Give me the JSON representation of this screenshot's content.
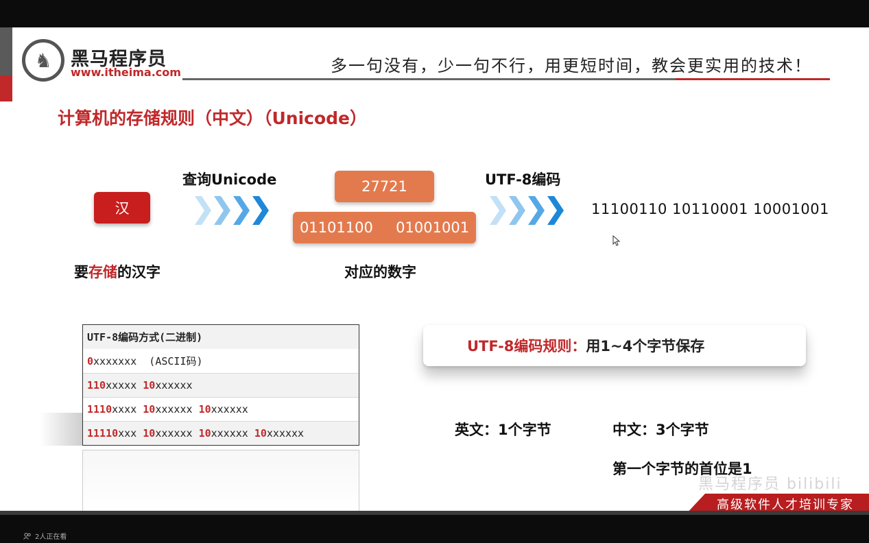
{
  "header": {
    "logo_name": "黑马程序员",
    "logo_url": "www.itheima.com",
    "slogan": "多一句没有，少一句不行，用更短时间，教会更实用的技术！"
  },
  "slide": {
    "title": "计算机的存储规则（中文）（Unicode）",
    "step1": {
      "char": "汉",
      "label_prefix": "要",
      "label_highlight": "存储",
      "label_suffix": "的汉字"
    },
    "arrow1_label": "查询Unicode",
    "step2": {
      "unicode_value": "27721",
      "binary_value": "01101100  01001001",
      "label": "对应的数字"
    },
    "arrow2_label": "UTF-8编码",
    "step3": {
      "utf8_bytes": "11100110 10110001 10001001"
    },
    "table": {
      "header": "UTF-8编码方式(二进制)",
      "rows": [
        {
          "parts": [
            {
              "t": "0",
              "r": true
            },
            {
              "t": "xxxxxxx  (ASCII码)",
              "r": false
            }
          ]
        },
        {
          "parts": [
            {
              "t": "110",
              "r": true
            },
            {
              "t": "xxxxx ",
              "r": false
            },
            {
              "t": "10",
              "r": true
            },
            {
              "t": "xxxxxx",
              "r": false
            }
          ]
        },
        {
          "parts": [
            {
              "t": "1110",
              "r": true
            },
            {
              "t": "xxxx ",
              "r": false
            },
            {
              "t": "10",
              "r": true
            },
            {
              "t": "xxxxxx ",
              "r": false
            },
            {
              "t": "10",
              "r": true
            },
            {
              "t": "xxxxxx",
              "r": false
            }
          ]
        },
        {
          "parts": [
            {
              "t": "11110",
              "r": true
            },
            {
              "t": "xxx ",
              "r": false
            },
            {
              "t": "10",
              "r": true
            },
            {
              "t": "xxxxxx ",
              "r": false
            },
            {
              "t": "10",
              "r": true
            },
            {
              "t": "xxxxxx ",
              "r": false
            },
            {
              "t": "10",
              "r": true
            },
            {
              "t": "xxxxxx",
              "r": false
            }
          ]
        }
      ]
    },
    "rule": {
      "highlight": "UTF-8编码规则：",
      "text": "用1~4个字节保存"
    },
    "english_bytes": "英文：1个字节",
    "chinese_bytes": "中文：3个字节",
    "first_bit_note": "第一个字节的首位是1"
  },
  "footer": {
    "banner": "高级软件人才培训专家",
    "viewers": "2人正在看"
  },
  "colors": {
    "brand_red": "#c0282a",
    "number_orange": "#e37a4e",
    "arrow_light": "#b9dcf5",
    "arrow_dark": "#1e88d8"
  },
  "icons": [
    "horse-logo-icon",
    "chevron-arrow-icon",
    "cursor-icon",
    "viewers-icon"
  ]
}
